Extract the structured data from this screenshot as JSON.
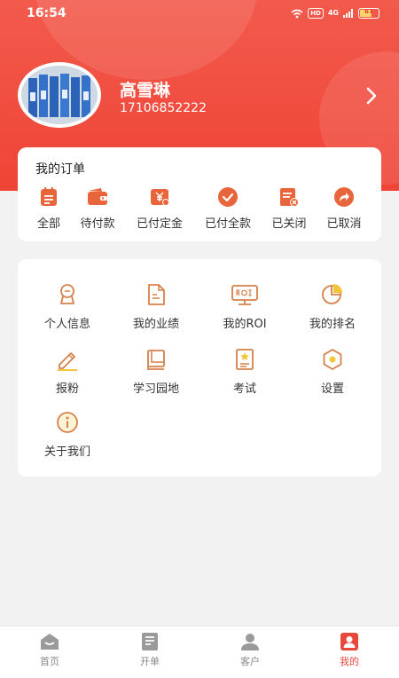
{
  "status_bar": {
    "time": "16:54",
    "hd": "HD",
    "network": "4G",
    "battery": "61"
  },
  "profile": {
    "name": "高雪琳",
    "phone": "17106852222"
  },
  "orders": {
    "title": "我的订单",
    "items": [
      {
        "label": "全部",
        "icon": "order-list-icon"
      },
      {
        "label": "待付款",
        "icon": "wallet-icon"
      },
      {
        "label": "已付定金",
        "icon": "deposit-paid-icon"
      },
      {
        "label": "已付全款",
        "icon": "check-circle-icon"
      },
      {
        "label": "已关闭",
        "icon": "closed-doc-icon"
      },
      {
        "label": "已取消",
        "icon": "share-arrow-icon"
      }
    ]
  },
  "menu": {
    "items": [
      {
        "label": "个人信息",
        "icon": "person-icon"
      },
      {
        "label": "我的业绩",
        "icon": "document-icon"
      },
      {
        "label": "我的ROI",
        "icon": "roi-monitor-icon"
      },
      {
        "label": "我的排名",
        "icon": "pie-chart-icon"
      },
      {
        "label": "报粉",
        "icon": "pen-icon"
      },
      {
        "label": "学习园地",
        "icon": "book-icon"
      },
      {
        "label": "考试",
        "icon": "exam-star-icon"
      },
      {
        "label": "设置",
        "icon": "settings-hex-icon"
      },
      {
        "label": "关于我们",
        "icon": "info-icon"
      }
    ]
  },
  "tabbar": {
    "tabs": [
      {
        "label": "首页",
        "icon": "home-icon"
      },
      {
        "label": "开单",
        "icon": "order-form-icon"
      },
      {
        "label": "客户",
        "icon": "customer-icon"
      },
      {
        "label": "我的",
        "icon": "mine-icon",
        "active": true
      }
    ]
  },
  "colors": {
    "brand": "#ef4436",
    "accent_orange": "#e8643a",
    "menu_icon": "#d6804a",
    "tab_inactive": "#9a9a9a"
  }
}
